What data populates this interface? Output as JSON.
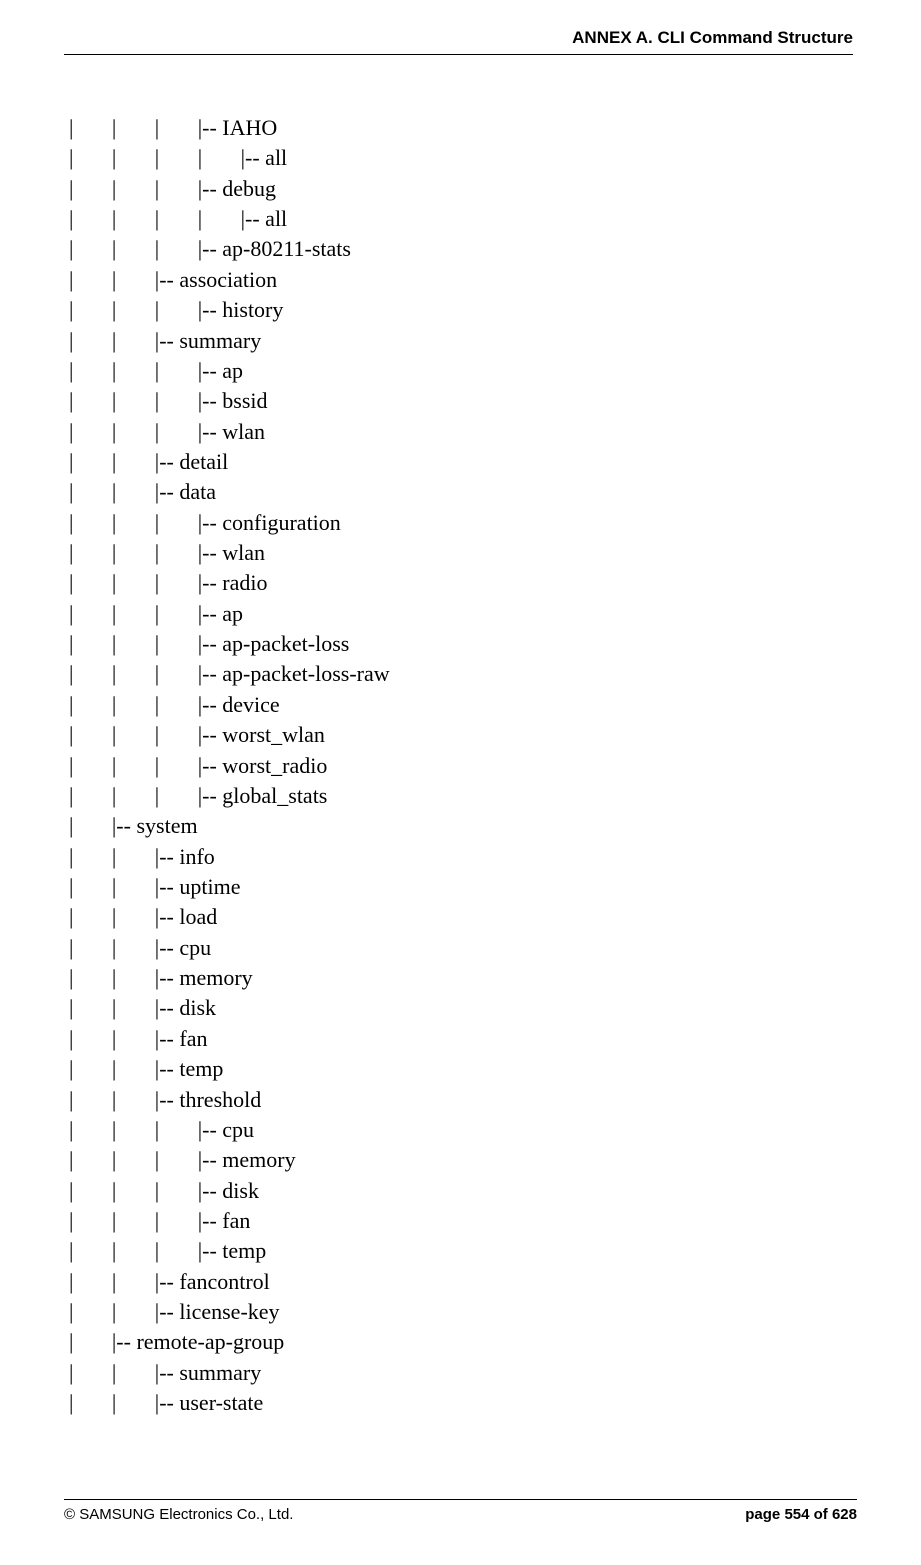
{
  "header": {
    "title": "ANNEX A. CLI Command Structure"
  },
  "tree": {
    "lines": [
      "|       |       |       |-- IAHO",
      "|       |       |       |       |-- all",
      "|       |       |       |-- debug",
      "|       |       |       |       |-- all",
      "|       |       |       |-- ap-80211-stats",
      "|       |       |-- association",
      "|       |       |       |-- history",
      "|       |       |-- summary",
      "|       |       |       |-- ap",
      "|       |       |       |-- bssid",
      "|       |       |       |-- wlan",
      "|       |       |-- detail",
      "|       |       |-- data",
      "|       |       |       |-- configuration",
      "|       |       |       |-- wlan",
      "|       |       |       |-- radio",
      "|       |       |       |-- ap",
      "|       |       |       |-- ap-packet-loss",
      "|       |       |       |-- ap-packet-loss-raw",
      "|       |       |       |-- device",
      "|       |       |       |-- worst_wlan",
      "|       |       |       |-- worst_radio",
      "|       |       |       |-- global_stats",
      "|       |-- system",
      "|       |       |-- info",
      "|       |       |-- uptime",
      "|       |       |-- load",
      "|       |       |-- cpu",
      "|       |       |-- memory",
      "|       |       |-- disk",
      "|       |       |-- fan",
      "|       |       |-- temp",
      "|       |       |-- threshold",
      "|       |       |       |-- cpu",
      "|       |       |       |-- memory",
      "|       |       |       |-- disk",
      "|       |       |       |-- fan",
      "|       |       |       |-- temp",
      "|       |       |-- fancontrol",
      "|       |       |-- license-key",
      "|       |-- remote-ap-group",
      "|       |       |-- summary",
      "|       |       |-- user-state"
    ]
  },
  "footer": {
    "copyright": "© SAMSUNG Electronics Co., Ltd.",
    "page": "page 554 of 628"
  }
}
